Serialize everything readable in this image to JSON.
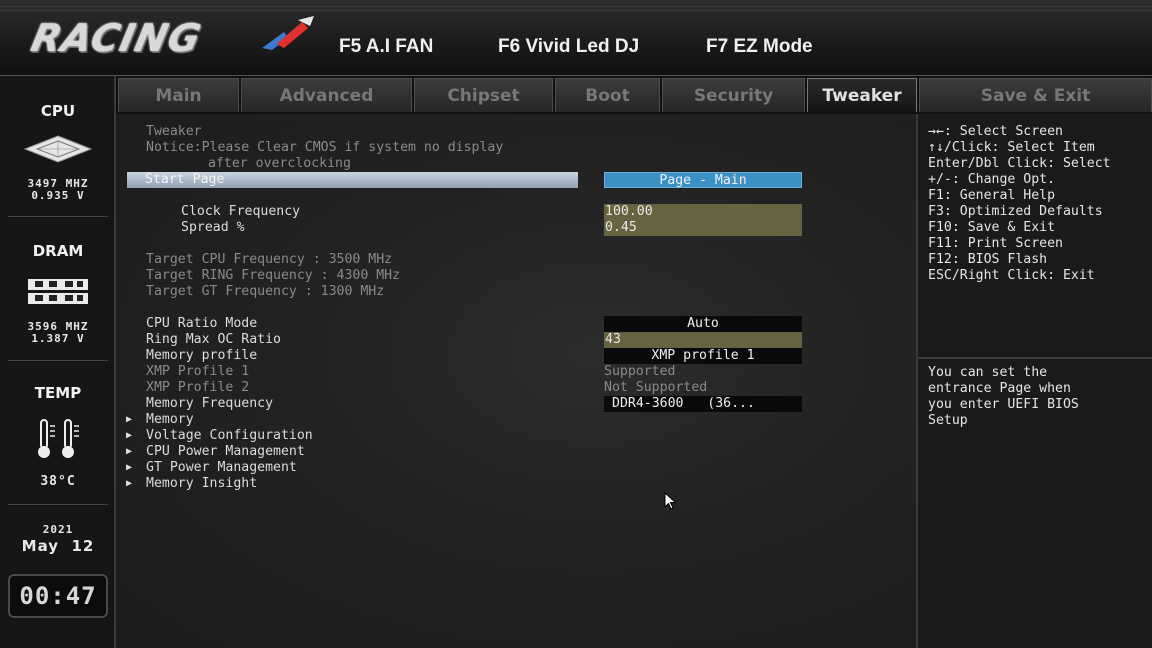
{
  "header": {
    "logo_text": "RACING",
    "function_keys": [
      "F5 A.I FAN",
      "F6 Vivid Led DJ",
      "F7 EZ Mode"
    ]
  },
  "sidebar": {
    "cpu": {
      "title": "CPU",
      "freq": "3497 MHZ",
      "volt": "0.935 V"
    },
    "dram": {
      "title": "DRAM",
      "freq": "3596 MHZ",
      "volt": "1.387 V"
    },
    "temp": {
      "title": "TEMP",
      "value": "38°C"
    },
    "date": {
      "year": "2021",
      "month_day": "May  12"
    },
    "time": "00:47"
  },
  "tabs": [
    "Main",
    "Advanced",
    "Chipset",
    "Boot",
    "Security",
    "Tweaker",
    "Save & Exit"
  ],
  "active_tab": "Tweaker",
  "main": {
    "section_title": "Tweaker",
    "notice_1": "Notice:Please Clear CMOS if system no display",
    "notice_2": "after overclocking",
    "start_page": {
      "label": "Start Page",
      "value": "Page - Main"
    },
    "clock_frequency": {
      "label": "Clock Frequency",
      "value": "100.00"
    },
    "spread": {
      "label": "Spread %",
      "value": "0.45"
    },
    "targets": [
      "Target CPU Frequency : 3500 MHz",
      "Target RING Frequency : 4300 MHz",
      "Target GT Frequency : 1300 MHz"
    ],
    "cpu_ratio_mode": {
      "label": "CPU Ratio Mode",
      "value": "Auto"
    },
    "ring_max_oc": {
      "label": "Ring Max OC Ratio",
      "value": "43"
    },
    "memory_profile": {
      "label": "Memory profile",
      "value": "XMP profile 1"
    },
    "xmp1": {
      "label": "XMP Profile 1",
      "value": "Supported"
    },
    "xmp2": {
      "label": "XMP Profile 2",
      "value": "Not Supported"
    },
    "memory_frequency": {
      "label": "Memory Frequency",
      "value": "DDR4-3600   (36..."
    },
    "submenus": [
      "Memory",
      "Voltage Configuration",
      "CPU Power Management",
      "GT Power Management",
      "Memory Insight"
    ]
  },
  "help": {
    "keys": [
      "→←: Select Screen",
      "↑↓/Click: Select Item",
      "Enter/Dbl Click: Select",
      "+/-: Change Opt.",
      "F1: General Help",
      "F3: Optimized Defaults",
      "F10: Save & Exit",
      "F11: Print Screen",
      "F12: BIOS Flash",
      "ESC/Right Click: Exit"
    ],
    "description": [
      "You can set the",
      "entrance Page when",
      "you enter UEFI BIOS",
      "Setup"
    ]
  },
  "colors": {
    "selected_row": "#8ea0b4",
    "blue_value": "#3a8fc4",
    "olive_value": "#67623f"
  }
}
